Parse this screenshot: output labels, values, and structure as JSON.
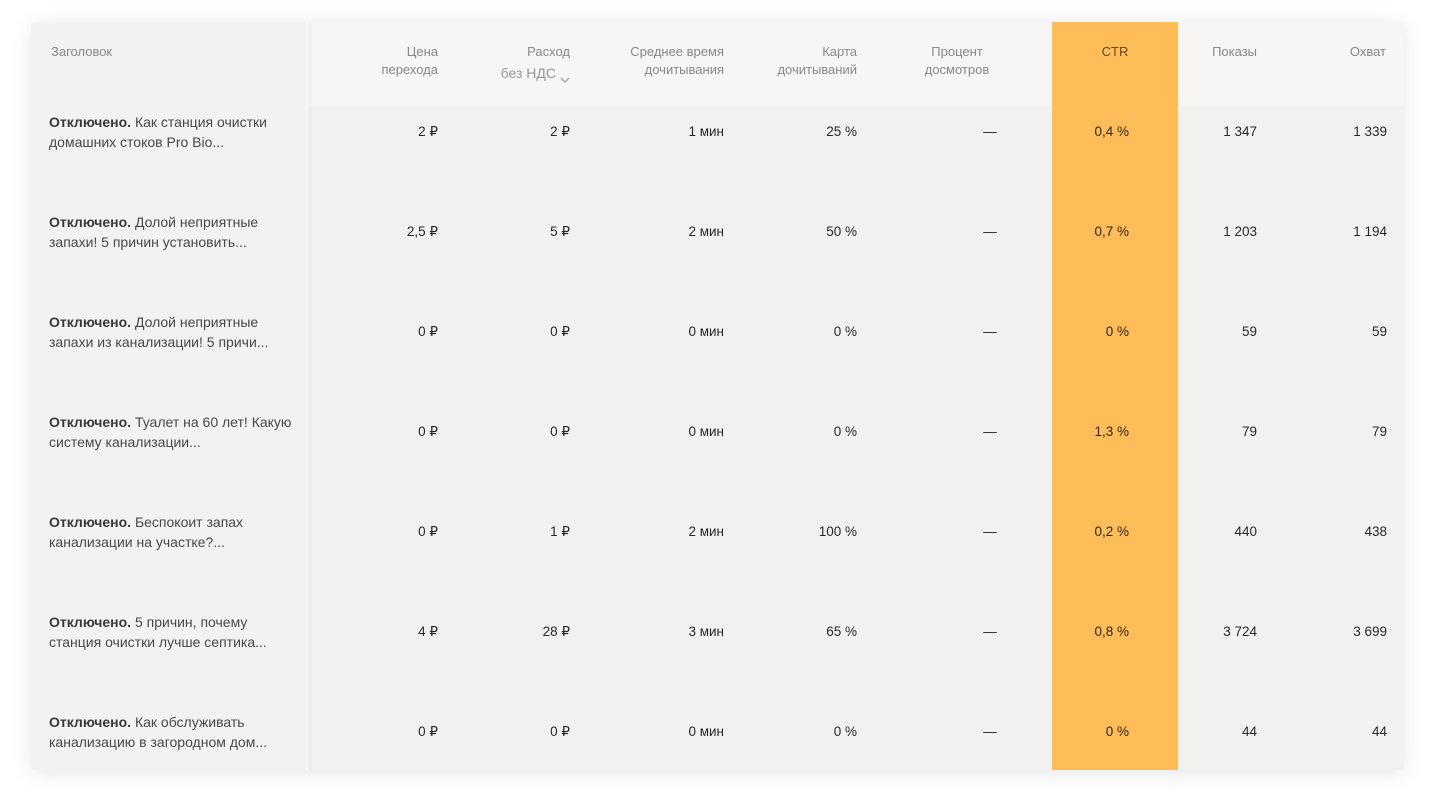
{
  "columns": {
    "title": "Заголовок",
    "cpc_l1": "Цена",
    "cpc_l2": "перехода",
    "spend_l1": "Расход",
    "spend_l2": "без НДС",
    "avg_time_l1": "Среднее время",
    "avg_time_l2": "дочитывания",
    "read_map_l1": "Карта",
    "read_map_l2": "дочитываний",
    "view_pct_l1": "Процент",
    "view_pct_l2": "досмотров",
    "ctr": "CTR",
    "impressions": "Показы",
    "reach": "Охват"
  },
  "colors": {
    "ctr_highlight": "#ffbd59",
    "background": "#f3f1ef"
  },
  "icons": {
    "sort": "chevron-down-icon"
  },
  "rows": [
    {
      "status": "Отключено.",
      "title": "Как станция очистки домашних стоков Pro Bio...",
      "cpc": "2 ₽",
      "spend": "2 ₽",
      "avg_time": "1 мин",
      "read_map": "25 %",
      "view_pct": "—",
      "ctr": "0,4 %",
      "impressions": "1 347",
      "reach": "1 339"
    },
    {
      "status": "Отключено.",
      "title": "Долой неприятные запахи! 5 причин установить...",
      "cpc": "2,5 ₽",
      "spend": "5 ₽",
      "avg_time": "2 мин",
      "read_map": "50 %",
      "view_pct": "—",
      "ctr": "0,7 %",
      "impressions": "1 203",
      "reach": "1 194"
    },
    {
      "status": "Отключено.",
      "title": "Долой неприятные запахи из канализации! 5 причи...",
      "cpc": "0 ₽",
      "spend": "0 ₽",
      "avg_time": "0 мин",
      "read_map": "0 %",
      "view_pct": "—",
      "ctr": "0 %",
      "impressions": "59",
      "reach": "59"
    },
    {
      "status": "Отключено.",
      "title": "Туалет на 60 лет! Какую систему канализации...",
      "cpc": "0 ₽",
      "spend": "0 ₽",
      "avg_time": "0 мин",
      "read_map": "0 %",
      "view_pct": "—",
      "ctr": "1,3 %",
      "impressions": "79",
      "reach": "79"
    },
    {
      "status": "Отключено.",
      "title": "Беспокоит запах канализации на участке?...",
      "cpc": "0 ₽",
      "spend": "1 ₽",
      "avg_time": "2 мин",
      "read_map": "100 %",
      "view_pct": "—",
      "ctr": "0,2 %",
      "impressions": "440",
      "reach": "438"
    },
    {
      "status": "Отключено.",
      "title": "5 причин, почему станция очистки лучше септика...",
      "cpc": "4 ₽",
      "spend": "28 ₽",
      "avg_time": "3 мин",
      "read_map": "65 %",
      "view_pct": "—",
      "ctr": "0,8 %",
      "impressions": "3 724",
      "reach": "3 699"
    },
    {
      "status": "Отключено.",
      "title": "Как обслуживать канализацию в загородном дом...",
      "cpc": "0 ₽",
      "spend": "0 ₽",
      "avg_time": "0 мин",
      "read_map": "0 %",
      "view_pct": "—",
      "ctr": "0 %",
      "impressions": "44",
      "reach": "44"
    }
  ]
}
